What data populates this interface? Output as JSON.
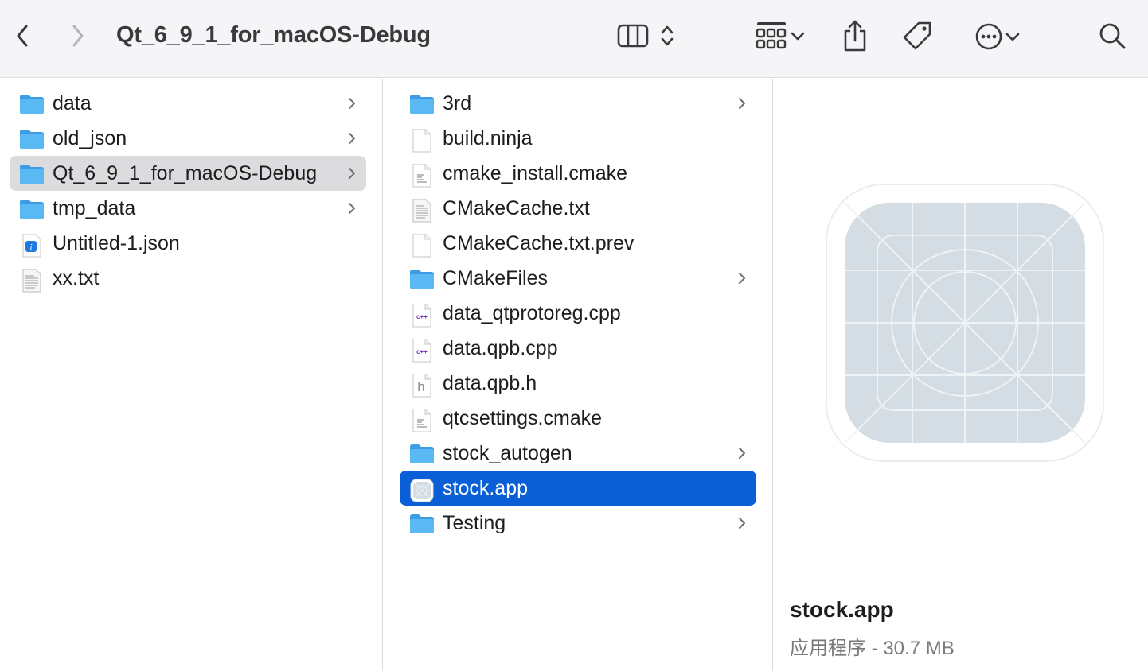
{
  "window": {
    "title": "Qt_6_9_1_for_macOS-Debug"
  },
  "toolbar": {
    "icons": [
      "back-icon",
      "forward-icon",
      "column-view-icon",
      "view-switch-icon",
      "group-icon",
      "chevron-down-icon",
      "share-icon",
      "tag-icon",
      "more-icon",
      "chevron-down-icon",
      "search-icon"
    ]
  },
  "column1": {
    "items": [
      {
        "label": "data",
        "type": "folder"
      },
      {
        "label": "old_json",
        "type": "folder"
      },
      {
        "label": "Qt_6_9_1_for_macOS-Debug",
        "type": "folder",
        "selected": true
      },
      {
        "label": "tmp_data",
        "type": "folder"
      },
      {
        "label": "Untitled-1.json",
        "type": "json"
      },
      {
        "label": "xx.txt",
        "type": "text"
      }
    ]
  },
  "column2": {
    "items": [
      {
        "label": "3rd",
        "type": "folder"
      },
      {
        "label": "build.ninja",
        "type": "blank"
      },
      {
        "label": "cmake_install.cmake",
        "type": "doc"
      },
      {
        "label": "CMakeCache.txt",
        "type": "text"
      },
      {
        "label": "CMakeCache.txt.prev",
        "type": "blank"
      },
      {
        "label": "CMakeFiles",
        "type": "folder"
      },
      {
        "label": "data_qtprotoreg.cpp",
        "type": "cpp"
      },
      {
        "label": "data.qpb.cpp",
        "type": "cpp"
      },
      {
        "label": "data.qpb.h",
        "type": "header"
      },
      {
        "label": "qtcsettings.cmake",
        "type": "doc"
      },
      {
        "label": "stock_autogen",
        "type": "folder"
      },
      {
        "label": "stock.app",
        "type": "app",
        "selected": true
      },
      {
        "label": "Testing",
        "type": "folder"
      }
    ]
  },
  "preview": {
    "name": "stock.app",
    "info": "应用程序 - 30.7 MB"
  },
  "colors": {
    "selection_blue": "#0a5fd6",
    "selection_gray": "#dcdcde",
    "folder_blue": "#5ab8f2"
  }
}
